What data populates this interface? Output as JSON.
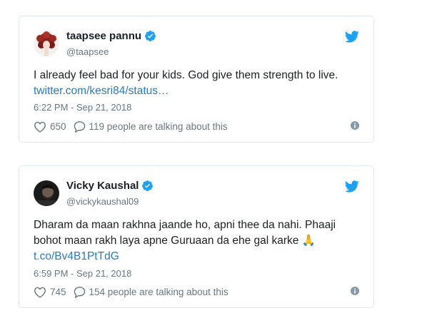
{
  "tweets": [
    {
      "name": "taapsee pannu",
      "handle": "@taapsee",
      "text": "I already feel bad for your kids. God give them strength to live.",
      "link": "twitter.com/kesri84/status…",
      "time": "6:22 PM - Sep 21, 2018",
      "likes": "650",
      "replies": "119 people are talking about this",
      "avatar_icon": "avatar-curly-hair",
      "verified_icon": "verified-badge-icon"
    },
    {
      "name": "Vicky Kaushal",
      "handle": "@vickykaushal09",
      "text_line1": "Dharam da maan rakhna jaande ho, apni thee da nahi. Phaaji",
      "text_line2": "bohot maan rakh laya apne Guruaan da ehe gal karke 🙏",
      "link": "t.co/Bv4B1PtTdG",
      "time": "6:59 PM - Sep 21, 2018",
      "likes": "745",
      "replies": "154 people are talking about this",
      "avatar_icon": "avatar-dark-photo",
      "verified_icon": "verified-badge-icon"
    }
  ],
  "icons": {
    "twitter": "twitter-bird-icon",
    "like": "heart-icon",
    "reply": "speech-bubble-icon",
    "info": "info-icon"
  },
  "colors": {
    "link": "#2b7bb9",
    "verified": "#1da1f2",
    "bird": "#1da1f2",
    "muted": "#697882",
    "border": "#e1e8ed"
  }
}
